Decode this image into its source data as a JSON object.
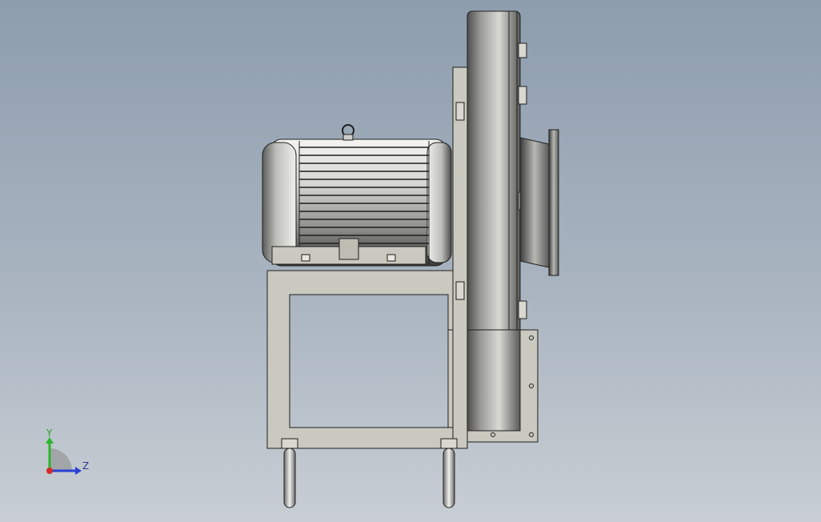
{
  "viewport": {
    "background_top": "#8d9dae",
    "background_bottom": "#c8ced4",
    "model_fill": "#c9c9bf",
    "model_edge": "#1e1e1e"
  },
  "triad": {
    "y_label": "Y",
    "z_label": "Z",
    "y_color": "#29b529",
    "z_color": "#2a3fd6",
    "origin_color": "#d62828",
    "x_color": "#d62828"
  },
  "model": {
    "parts": [
      "motor-housing",
      "motor-lifting-eye",
      "motor-base-plate",
      "support-frame",
      "fan-impeller-housing",
      "outlet-flange",
      "mounting-bracket",
      "support-legs"
    ]
  }
}
